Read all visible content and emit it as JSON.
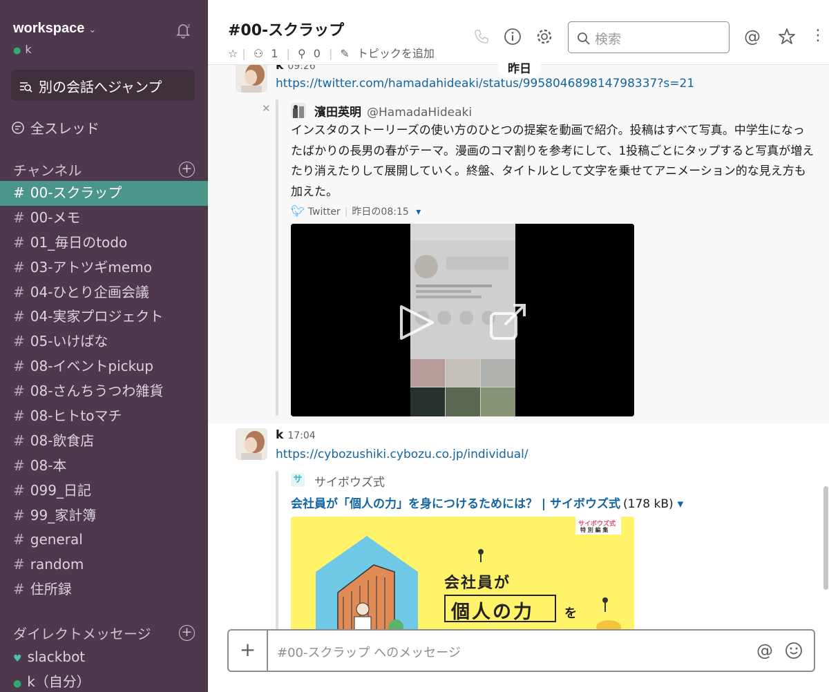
{
  "sidebar": {
    "workspace_name": "workspace",
    "user_name": "k",
    "jump_label": "別の会話へジャンプ",
    "threads_label": "全スレッド",
    "channels_heading": "チャンネル",
    "channels": [
      "00-スクラップ",
      "00-メモ",
      "01_毎日のtodo",
      "03-アトツギmemo",
      "04-ひとり企画会議",
      "04-実家プロジェクト",
      "05-いけばな",
      "08-イベントpickup",
      "08-さんちうつわ雑貨",
      "08-ヒトtoマチ",
      "08-飲食店",
      "08-本",
      "099_日記",
      "99_家計簿",
      "general",
      "random",
      "住所録"
    ],
    "active_channel": "00-スクラップ",
    "dm_heading": "ダイレクトメッセージ",
    "dms": [
      "slackbot",
      "k（自分）"
    ]
  },
  "header": {
    "channel_title": "#00-スクラップ",
    "members_count": "1",
    "pins_count": "0",
    "topic_label": "トピックを追加",
    "search_placeholder": "検索",
    "day_divider": "昨日"
  },
  "messages": [
    {
      "author": "k",
      "time": "09:26",
      "link": "https://twitter.com/hamadahideaki/status/995804689814798337?s=21",
      "tweet": {
        "name": "濱田英明",
        "handle": "@HamadaHideaki",
        "text": "インスタのストーリーズの使い方のひとつの提案を動画で紹介。投稿はすべて写真。中学生になったばかりの長男の春がテーマ。漫画のコマ割りを参考にして、1投稿ごとにタップすると写真が増えたり消えたりして展開していく。終盤、タイトルとして文字を乗せてアニメーション的な見え方も加えた。",
        "source": "Twitter",
        "timestamp": "昨日の08:15"
      }
    },
    {
      "author": "k",
      "time": "17:04",
      "link": "https://cybozushiki.cybozu.co.jp/individual/",
      "unfurl": {
        "site_name": "サイボウズ式",
        "title": "会社員が「個人の力」を身につけるためには？ | サイボウズ式",
        "size": "(178 kB)",
        "image_badge_1": "サイボウズ式",
        "image_badge_2": "特 別 編 集",
        "image_text_1": "会社員が",
        "image_text_2": "個人の力",
        "image_text_3": "を"
      }
    }
  ],
  "composer": {
    "placeholder": "#00-スクラップ へのメッセージ"
  },
  "colors": {
    "sidebar_bg": "#4d394b",
    "active_channel_bg": "#4c9689",
    "link": "#1264a3",
    "presence": "#2bac76"
  }
}
